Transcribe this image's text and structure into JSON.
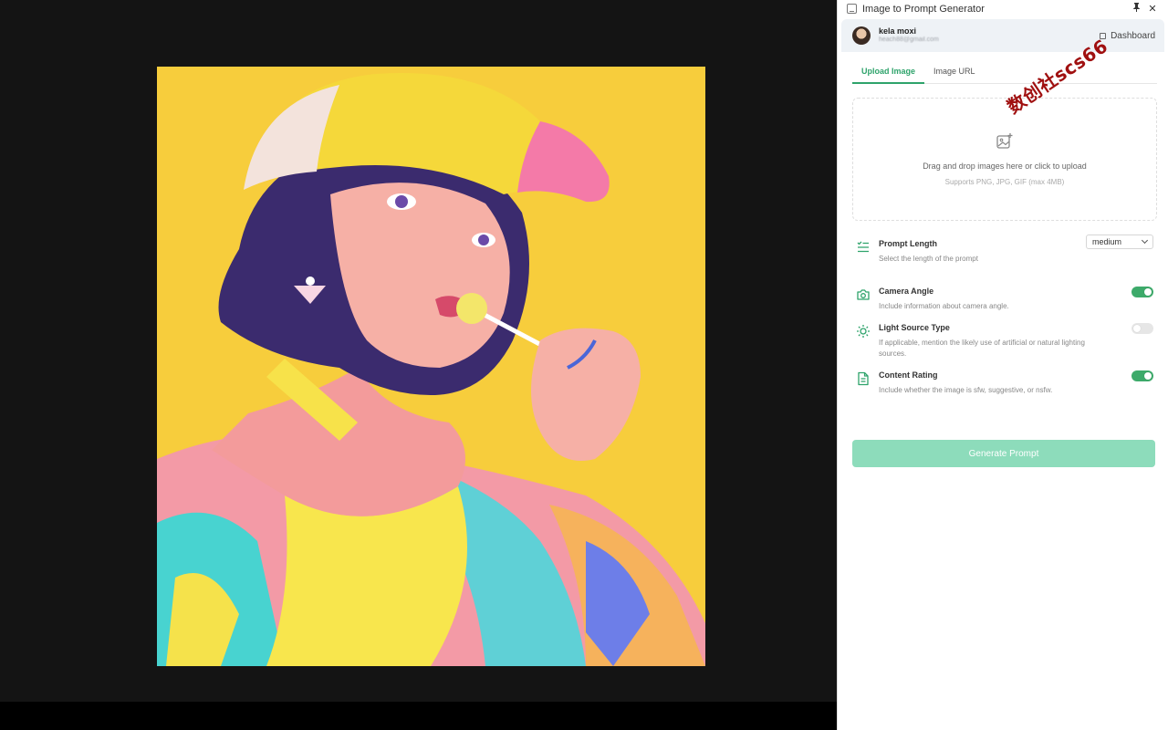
{
  "window": {
    "title": "Image to Prompt Generator",
    "pin_icon": "pin-icon",
    "close_label": "✕"
  },
  "user": {
    "name": "kela moxi",
    "email": "heach88@gmail.com",
    "dashboard_label": "Dashboard"
  },
  "watermark": {
    "text": "数创社scs66"
  },
  "tabs": [
    {
      "label": "Upload Image",
      "active": true
    },
    {
      "label": "Image URL",
      "active": false
    }
  ],
  "upload": {
    "primary": "Drag and drop images here or click to upload",
    "secondary": "Supports PNG, JPG, GIF (max 4MB)"
  },
  "options": {
    "prompt_length": {
      "title": "Prompt Length",
      "desc": "Select the length of the prompt",
      "value": "medium",
      "icon": "list-icon"
    },
    "camera_angle": {
      "title": "Camera Angle",
      "desc": "Include information about camera angle.",
      "enabled": true,
      "icon": "camera-icon"
    },
    "light_source": {
      "title": "Light Source Type",
      "desc": "If applicable, mention the likely use of artificial or natural lighting sources.",
      "enabled": false,
      "icon": "sun-icon"
    },
    "content_rating": {
      "title": "Content Rating",
      "desc": "Include whether the image is sfw, suggestive, or nsfw.",
      "enabled": true,
      "icon": "document-icon"
    }
  },
  "generate": {
    "label": "Generate Prompt"
  },
  "colors": {
    "accent": "#2ea36b",
    "toggle_on": "#3daa6a",
    "button_disabled": "#8ddcbb",
    "artwork_bg": "#f7cd3c"
  }
}
